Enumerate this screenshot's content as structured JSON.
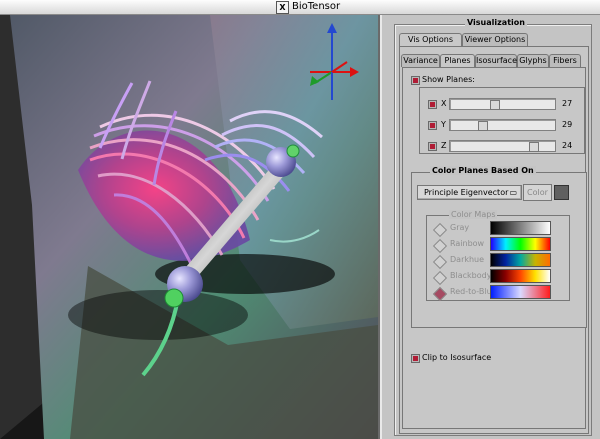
{
  "window": {
    "title": "BioTensor",
    "icon": "x-window-icon"
  },
  "viewer": {
    "name": "3D tensor visualization viewport",
    "axis_colors": {
      "x": "#d11",
      "y": "#1f9b2a",
      "z": "#2448d0"
    }
  },
  "visualization": {
    "frame_title": "Visualization",
    "top_tabs": [
      {
        "label": "Vis Options",
        "active": true
      },
      {
        "label": "Viewer Options",
        "active": false
      }
    ],
    "sub_tabs": [
      {
        "label": "Variance",
        "active": false
      },
      {
        "label": "Planes",
        "active": true
      },
      {
        "label": "Isosurface",
        "active": false
      },
      {
        "label": "Glyphs",
        "active": false
      },
      {
        "label": "Fibers",
        "active": false
      }
    ],
    "show_planes": {
      "label": "Show Planes:",
      "checked": true
    },
    "planes": [
      {
        "axis": "X",
        "checked": true,
        "value": 27,
        "position": 0.42
      },
      {
        "axis": "Y",
        "checked": true,
        "value": 29,
        "position": 0.29
      },
      {
        "axis": "Z",
        "checked": true,
        "value": 24,
        "position": 0.83
      }
    ],
    "color_planes": {
      "title": "Color Planes Based On",
      "selected": "Principle Eigenvector",
      "color_button": "Color"
    },
    "color_maps": {
      "title": "Color Maps",
      "items": [
        {
          "name": "Gray",
          "selected": false
        },
        {
          "name": "Rainbow",
          "selected": false
        },
        {
          "name": "Darkhue",
          "selected": false
        },
        {
          "name": "Blackbody",
          "selected": false
        },
        {
          "name": "Red-to-Blue",
          "selected": true
        }
      ]
    },
    "clip": {
      "label": "Clip to Isosurface",
      "checked": true
    }
  }
}
